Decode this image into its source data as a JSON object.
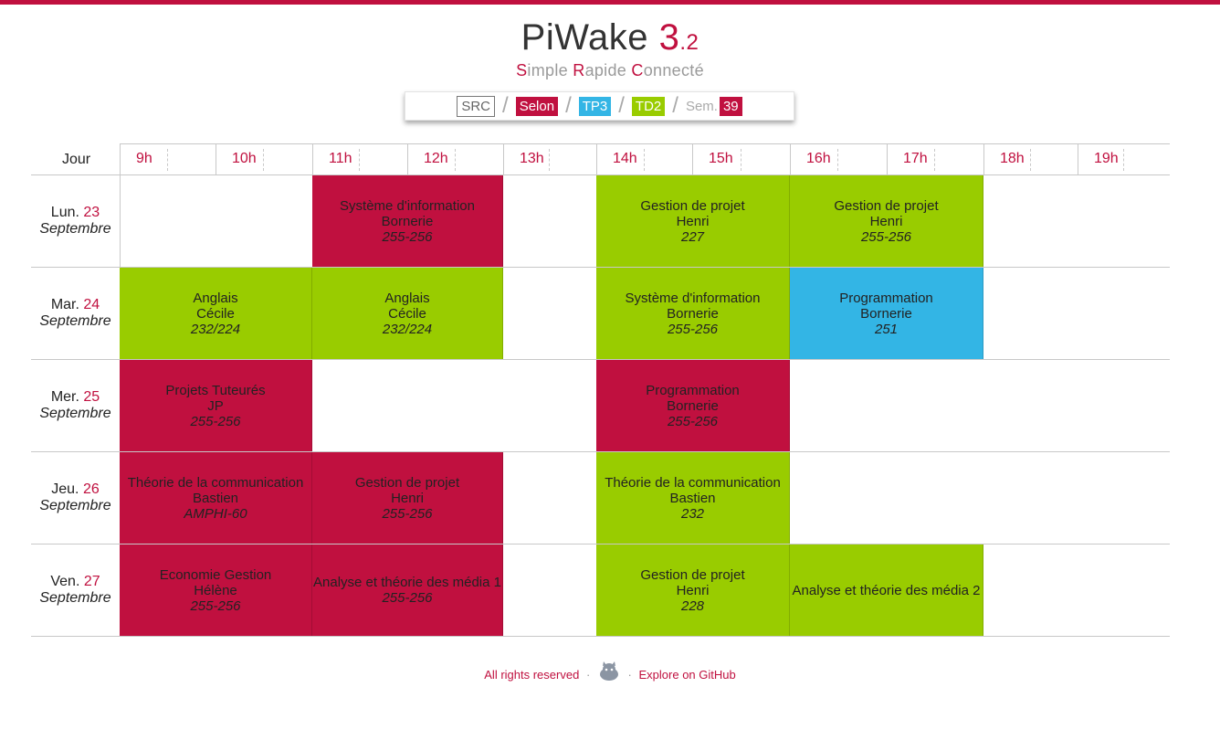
{
  "header": {
    "title": "PiWake",
    "version_major": "3",
    "version_minor": ".2",
    "tagline": {
      "cap1": "S",
      "rest1": "imple ",
      "cap2": "R",
      "rest2": "apide ",
      "cap3": "C",
      "rest3": "onnecté"
    }
  },
  "selector": {
    "department": "SRC",
    "group": "Selon",
    "tp": "TP3",
    "td": "TD2",
    "week_label": "Sem.",
    "week": "39"
  },
  "timetable": {
    "day_column_label": "Jour",
    "hours": [
      "9h",
      "10h",
      "11h",
      "12h",
      "13h",
      "14h",
      "15h",
      "16h",
      "17h",
      "18h",
      "19h"
    ],
    "days": [
      {
        "name": "Lun.",
        "date": "23",
        "month": "Septembre",
        "courses": [
          {
            "title": "Système d'information",
            "teacher": "Bornerie",
            "room": "255-256",
            "color": "red"
          },
          {
            "title": "Gestion de projet",
            "teacher": "Henri",
            "room": "227",
            "color": "green"
          },
          {
            "title": "Gestion de projet",
            "teacher": "Henri",
            "room": "255-256",
            "color": "green"
          }
        ]
      },
      {
        "name": "Mar.",
        "date": "24",
        "month": "Septembre",
        "courses": [
          {
            "title": "Anglais",
            "teacher": "Cécile",
            "room": "232/224",
            "color": "green"
          },
          {
            "title": "Anglais",
            "teacher": "Cécile",
            "room": "232/224",
            "color": "green"
          },
          {
            "title": "Système d'information",
            "teacher": "Bornerie",
            "room": "255-256",
            "color": "green"
          },
          {
            "title": "Programmation",
            "teacher": "Bornerie",
            "room": "251",
            "color": "blue"
          }
        ]
      },
      {
        "name": "Mer.",
        "date": "25",
        "month": "Septembre",
        "courses": [
          {
            "title": "Projets Tuteurés",
            "teacher": "JP",
            "room": "255-256",
            "color": "red"
          },
          {
            "title": "Programmation",
            "teacher": "Bornerie",
            "room": "255-256",
            "color": "red"
          }
        ]
      },
      {
        "name": "Jeu.",
        "date": "26",
        "month": "Septembre",
        "courses": [
          {
            "title": "Théorie de la communication",
            "teacher": "Bastien",
            "room": "AMPHI-60",
            "color": "red"
          },
          {
            "title": "Gestion de projet",
            "teacher": "Henri",
            "room": "255-256",
            "color": "red"
          },
          {
            "title": "Théorie de la communication",
            "teacher": "Bastien",
            "room": "232",
            "color": "green"
          }
        ]
      },
      {
        "name": "Ven.",
        "date": "27",
        "month": "Septembre",
        "courses": [
          {
            "title": "Economie Gestion",
            "teacher": "Hélène",
            "room": "255-256",
            "color": "red"
          },
          {
            "title": "Analyse et théorie des média 1",
            "teacher": "",
            "room": "255-256",
            "color": "red"
          },
          {
            "title": "Gestion de projet",
            "teacher": "Henri",
            "room": "228",
            "color": "green"
          },
          {
            "title": "Analyse et théorie des média 2",
            "teacher": "",
            "room": "",
            "color": "green"
          }
        ]
      }
    ]
  },
  "footer": {
    "rights": "All rights reserved",
    "separator": "·",
    "github_link": "Explore on GitHub",
    "icon": "octocat-icon"
  },
  "colors": {
    "accent": "#c0103f",
    "green": "#99cc00",
    "blue": "#33b5e5"
  }
}
